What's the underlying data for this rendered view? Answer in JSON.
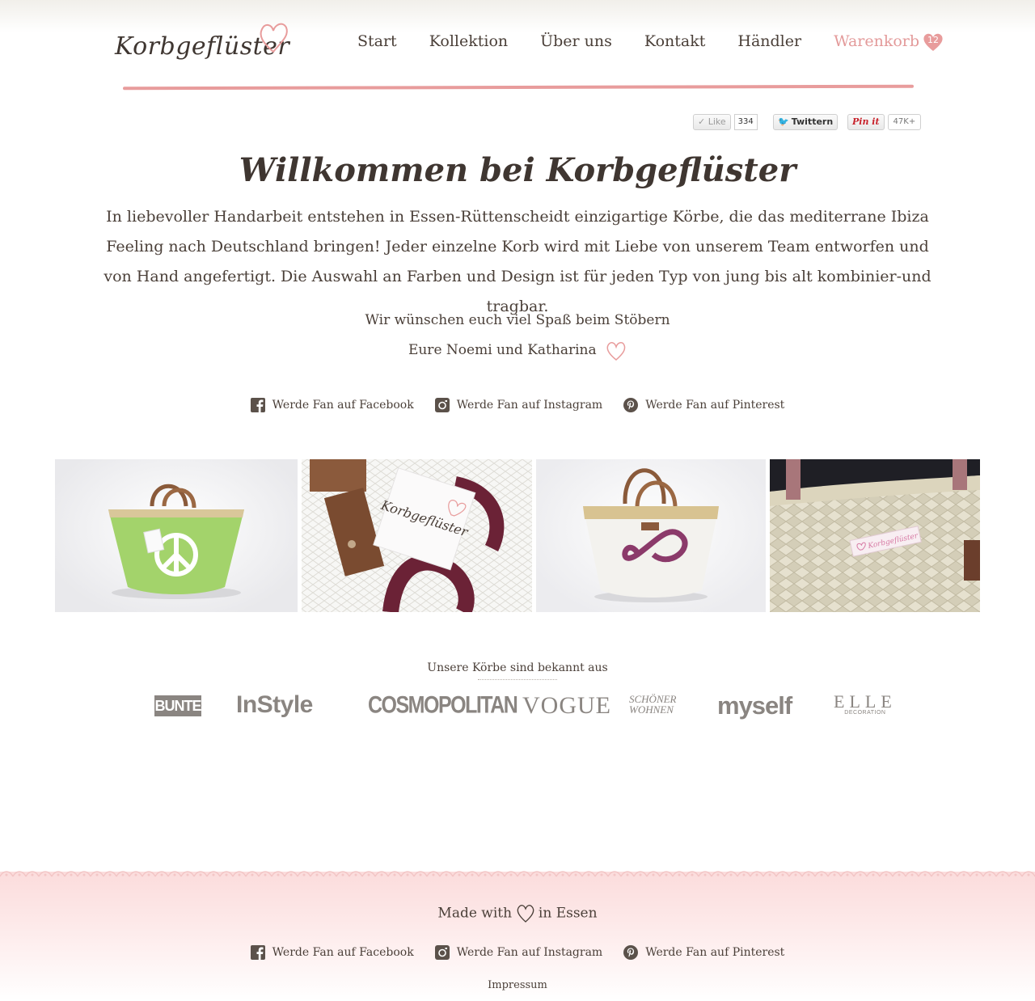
{
  "brand": {
    "logo_text": "Korbgeflüster"
  },
  "nav": {
    "items": [
      {
        "label": "Start"
      },
      {
        "label": "Kollektion"
      },
      {
        "label": "Über uns"
      },
      {
        "label": "Kontakt"
      },
      {
        "label": "Händler"
      }
    ],
    "cart_label": "Warenkorb",
    "cart_count": "12"
  },
  "share": {
    "like_label": "Like",
    "like_count": "334",
    "twitter_label": "Twittern",
    "pin_label": "Pin it",
    "pin_count": "47K+"
  },
  "hero": {
    "title": "Willkommen bei Korbgeflüster",
    "intro": "In liebevoller Handarbeit entstehen in Essen-Rüttenscheidt einzigartige Körbe, die das mediterrane Ibiza Feeling nach Deutschland bringen! Jeder einzelne Korb wird mit Liebe von unserem Team entworfen und von Hand angefertigt. Die Auswahl an Farben und Design ist für jeden Typ von jung bis alt kombinier-und tragbar.",
    "greeting_line1": "Wir wünschen euch viel Spaß beim Stöbern",
    "greeting_line2": "Eure Noemi und Katharina"
  },
  "fans": {
    "facebook": "Werde Fan auf Facebook",
    "instagram": "Werde Fan auf Instagram",
    "pinterest": "Werde Fan auf Pinterest"
  },
  "gallery": {
    "tag_logo_text": "Korbgeflüster",
    "tag_small_text": "Korbgeflüster"
  },
  "press": {
    "title": "Unsere Körbe sind bekannt aus",
    "logos": [
      "BUNTE",
      "InStyle",
      "COSMOPOLITAN",
      "VOGUE",
      "SCHÖNER",
      "WOHNEN",
      "myself",
      "ELLE",
      "DECORATION"
    ]
  },
  "footer": {
    "made_prefix": "Made with",
    "made_suffix": "in Essen",
    "impressum": "Impressum"
  },
  "colors": {
    "text": "#4a3f38",
    "accent_pink": "#e39a9a",
    "rule_pink": "#e89c9c",
    "footer_pink": "#fbdcdc"
  }
}
